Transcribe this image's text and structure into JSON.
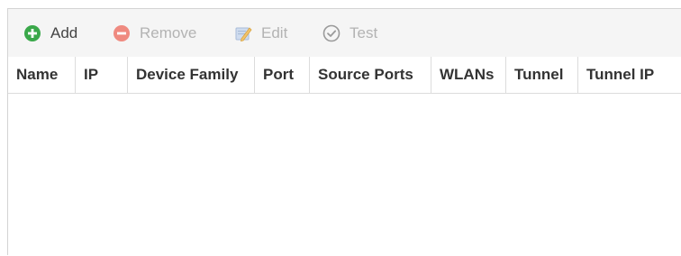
{
  "toolbar": {
    "add_label": "Add",
    "remove_label": "Remove",
    "edit_label": "Edit",
    "test_label": "Test",
    "icons": {
      "add": "add-circle-icon",
      "remove": "remove-circle-icon",
      "edit": "edit-pencil-icon",
      "test": "check-circle-icon"
    }
  },
  "table": {
    "columns": [
      "Name",
      "IP",
      "Device Family",
      "Port",
      "Source Ports",
      "WLANs",
      "Tunnel",
      "Tunnel IP"
    ],
    "rows": []
  },
  "colors": {
    "add_green": "#3aa84a",
    "remove_red": "#ef8a80",
    "disabled_text": "#b3b3b3",
    "toolbar_bg": "#f5f5f5"
  }
}
